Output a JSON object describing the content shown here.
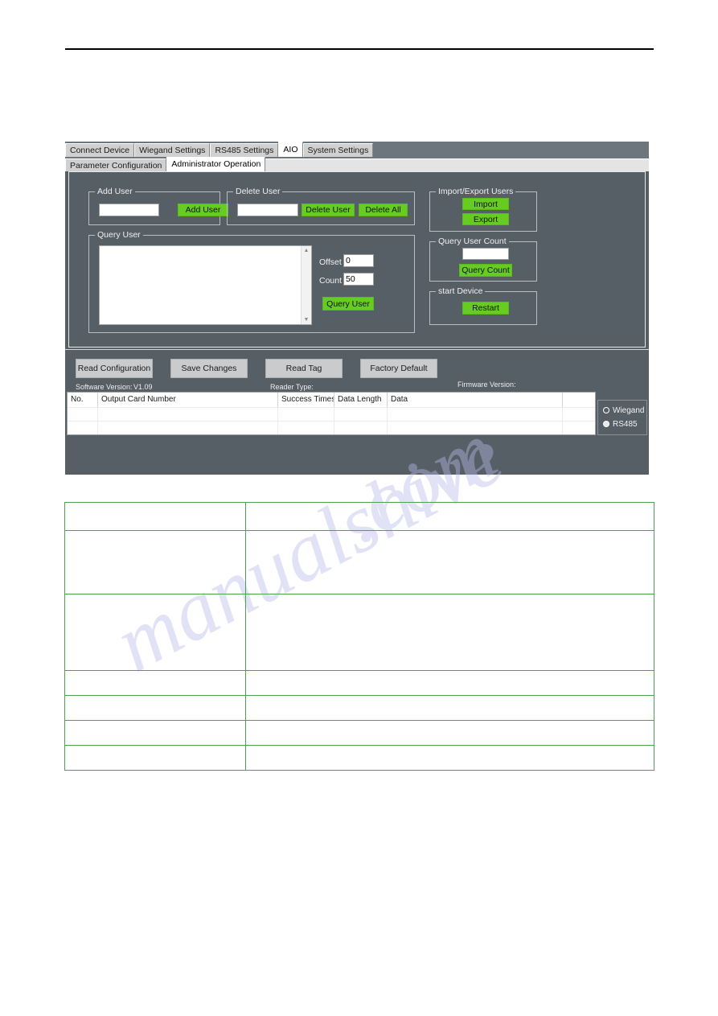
{
  "window": {
    "tabs": [
      {
        "label": "Connect Device",
        "active": false
      },
      {
        "label": "Wiegand Settings",
        "active": false
      },
      {
        "label": "RS485 Settings",
        "active": false
      },
      {
        "label": "AIO",
        "active": true
      },
      {
        "label": "System Settings",
        "active": false
      }
    ],
    "subtabs": [
      {
        "label": "Parameter Configuration",
        "active": false
      },
      {
        "label": "Administrator Operation",
        "active": true
      }
    ]
  },
  "add_user": {
    "title": "Add User",
    "input_value": "",
    "button": "Add User"
  },
  "delete_user": {
    "title": "Delete User",
    "input_value": "",
    "delete_button": "Delete User",
    "delete_all_button": "Delete All"
  },
  "query_user": {
    "title": "Query User",
    "list_value": "",
    "offset_label": "Offset",
    "offset_value": "0",
    "count_label": "Count",
    "count_value": "50",
    "button": "Query User"
  },
  "import_export": {
    "title": "Import/Export Users",
    "import_button": "Import",
    "export_button": "Export"
  },
  "query_user_count": {
    "title": "Query User Count",
    "input_value": "",
    "button": "Query Count"
  },
  "start_device": {
    "title": "start Device",
    "button": "Restart"
  },
  "commands": {
    "read_configuration": "Read Configuration",
    "save_changes": "Save Changes",
    "read_tag": "Read Tag",
    "factory_default": "Factory Default"
  },
  "status": {
    "software_version_label": "Software Version:",
    "software_version_value": "V1.09",
    "reader_type_label": "Reader Type:",
    "reader_type_value": "",
    "firmware_version_label": "Firmware Version:",
    "firmware_version_value": ""
  },
  "grid": {
    "columns": [
      "No.",
      "Output Card Number",
      "Success Times",
      "Data Length",
      "Data",
      ""
    ],
    "rows": [
      [
        "",
        "",
        "",
        "",
        "",
        ""
      ],
      [
        "",
        "",
        "",
        "",
        "",
        ""
      ]
    ]
  },
  "mode_radio": {
    "wiegand_label": "Wiegand",
    "wiegand_selected": false,
    "rs485_label": "RS485",
    "rs485_selected": true
  },
  "watermark": {
    "line1": "manualshive",
    "line2": ".com"
  },
  "doc_table": {
    "rows": [
      {
        "col1": "",
        "col2": ""
      },
      {
        "col1": "",
        "col2": ""
      },
      {
        "col1": "",
        "col2": ""
      },
      {
        "col1": "",
        "col2": ""
      },
      {
        "col1": "",
        "col2": ""
      },
      {
        "col1": "",
        "col2": ""
      },
      {
        "col1": "",
        "col2": ""
      }
    ]
  },
  "colors": {
    "accent_green": "#66CC22",
    "panel_dark": "#565E66",
    "table_border_green": "#4EA24E"
  }
}
